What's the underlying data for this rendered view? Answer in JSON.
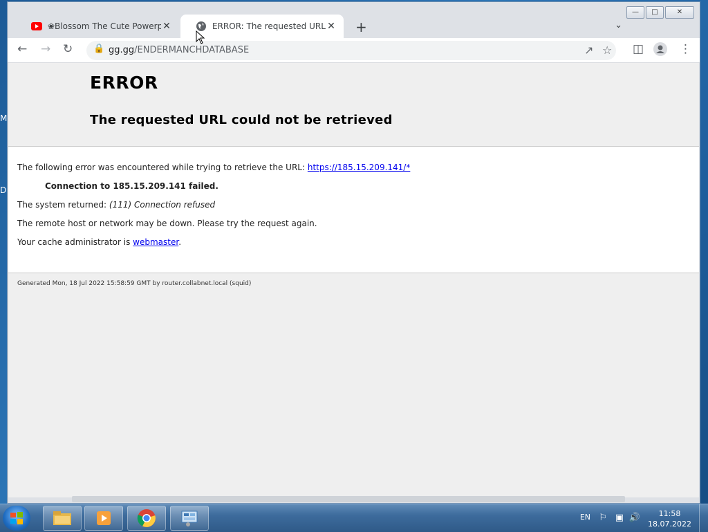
{
  "desktop": {
    "edge_letters": [
      "M",
      "D"
    ]
  },
  "tabs": [
    {
      "title": "❀Blossom The Cute Powerpuff G",
      "icon": "youtube-icon",
      "active": false
    },
    {
      "title": "ERROR: The requested URL could",
      "icon": "globe-icon",
      "active": true
    }
  ],
  "toolbar": {
    "url_domain": "gg.gg",
    "url_path": "/ENDERMANCHDATABASE"
  },
  "page": {
    "h1": "ERROR",
    "h2": "The requested URL could not be retrieved",
    "line1_prefix": "The following error was encountered while trying to retrieve the URL:",
    "line1_link": "https://185.15.209.141/*",
    "line2": "Connection to 185.15.209.141 failed.",
    "line3_prefix": "The system returned:",
    "line3_value": "(111) Connection refused",
    "line4": "The remote host or network may be down. Please try the request again.",
    "line5_prefix": "Your cache administrator is",
    "line5_link": "webmaster",
    "line5_suffix": ".",
    "footer": "Generated Mon, 18 Jul 2022 15:58:59 GMT by router.collabnet.local (squid)"
  },
  "taskbar": {
    "apps": [
      "file-explorer-icon",
      "media-player-icon",
      "chrome-icon",
      "control-panel-icon"
    ],
    "language": "EN",
    "time": "11:58",
    "date": "18.07.2022"
  },
  "colors": {
    "link": "#0000ee",
    "youtube": "#ff0000",
    "page_bg": "#efefef"
  }
}
